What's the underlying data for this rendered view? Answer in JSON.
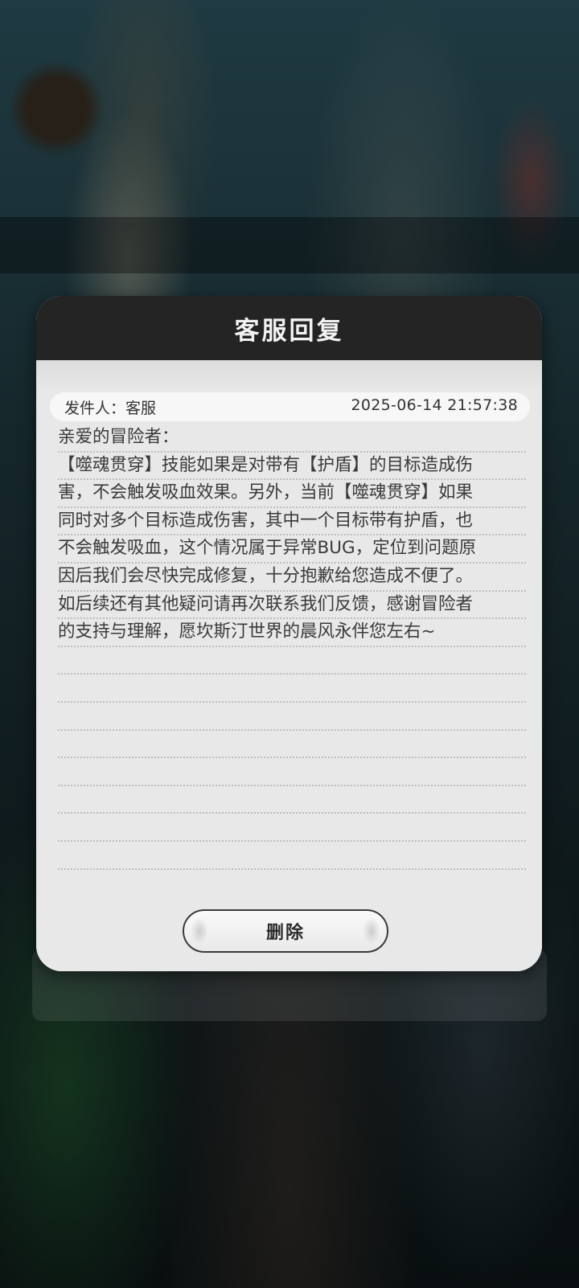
{
  "dialog": {
    "title": "客服回复",
    "sender_label": "发件人：",
    "sender_name": "客服",
    "timestamp": "2025-06-14 21:57:38",
    "body_lines": [
      "亲爱的冒险者：",
      "【噬魂贯穿】技能如果是对带有【护盾】的目标造成伤",
      "害，不会触发吸血效果。另外，当前【噬魂贯穿】如果",
      "同时对多个目标造成伤害，其中一个目标带有护盾，也",
      "不会触发吸血，这个情况属于异常BUG，定位到问题原",
      "因后我们会尽快完成修复，十分抱歉给您造成不便了。",
      "如后续还有其他疑问请再次联系我们反馈，感谢冒险者",
      "的支持与理解，愿坎斯汀世界的晨风永伴您左右~"
    ],
    "delete_label": "删除"
  }
}
